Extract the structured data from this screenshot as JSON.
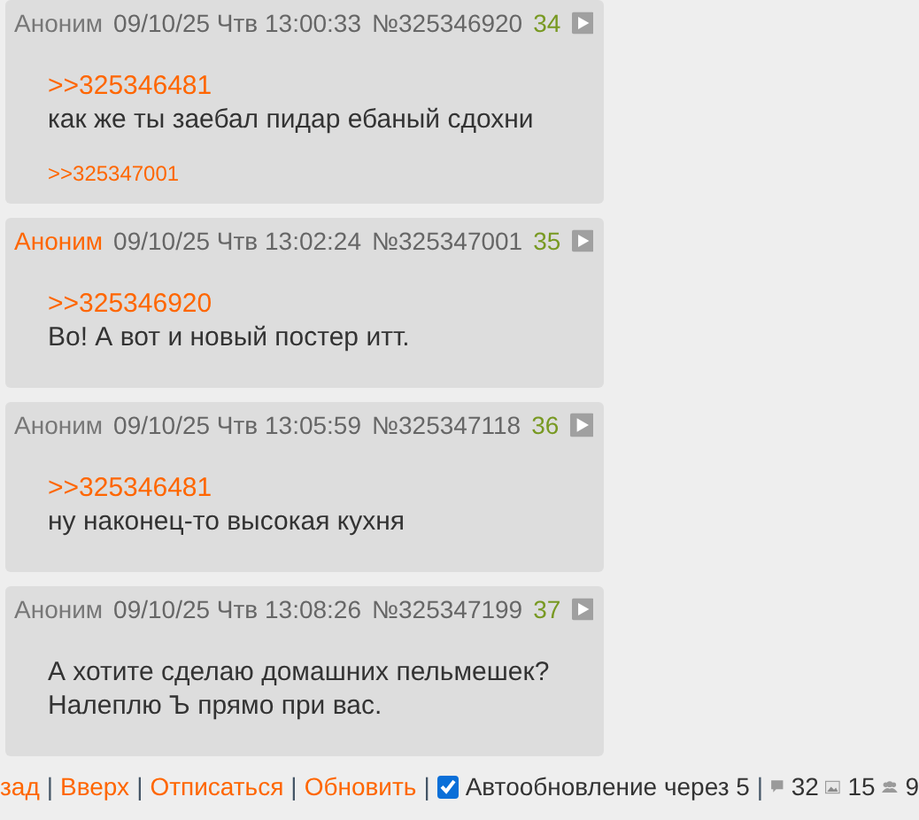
{
  "posts": [
    {
      "author": "Аноним",
      "author_highlighted": false,
      "date": "09/10/25 Чтв 13:00:33",
      "number": "№325346920",
      "index": "34",
      "lines": [
        {
          "kind": "quote",
          "text": ">>325346481"
        },
        {
          "kind": "text",
          "text": "как же ты заебал пидар ебаный сдохни"
        }
      ],
      "replies": [
        ">>325347001"
      ]
    },
    {
      "author": "Аноним",
      "author_highlighted": true,
      "date": "09/10/25 Чтв 13:02:24",
      "number": "№325347001",
      "index": "35",
      "lines": [
        {
          "kind": "quote",
          "text": ">>325346920"
        },
        {
          "kind": "text",
          "text": "Во! А вот и новый постер итт."
        }
      ]
    },
    {
      "author": "Аноним",
      "author_highlighted": false,
      "date": "09/10/25 Чтв 13:05:59",
      "number": "№325347118",
      "index": "36",
      "lines": [
        {
          "kind": "quote",
          "text": ">>325346481"
        },
        {
          "kind": "text",
          "text": "ну наконец-то высокая кухня"
        }
      ]
    },
    {
      "author": "Аноним",
      "author_highlighted": false,
      "date": "09/10/25 Чтв 13:08:26",
      "number": "№325347199",
      "index": "37",
      "lines": [
        {
          "kind": "text",
          "text": "А хотите сделаю домашних пельмешек?"
        },
        {
          "kind": "text",
          "text": "Налеплю Ъ прямо при вас."
        }
      ]
    }
  ],
  "footer": {
    "links": [
      "зад",
      "Вверх",
      "Отписаться",
      "Обновить"
    ],
    "separator": "|",
    "autoupdate": {
      "checked": true,
      "label": "Автообновление через 5"
    },
    "stats": {
      "posts": "32",
      "images": "15",
      "posters": "9"
    }
  }
}
